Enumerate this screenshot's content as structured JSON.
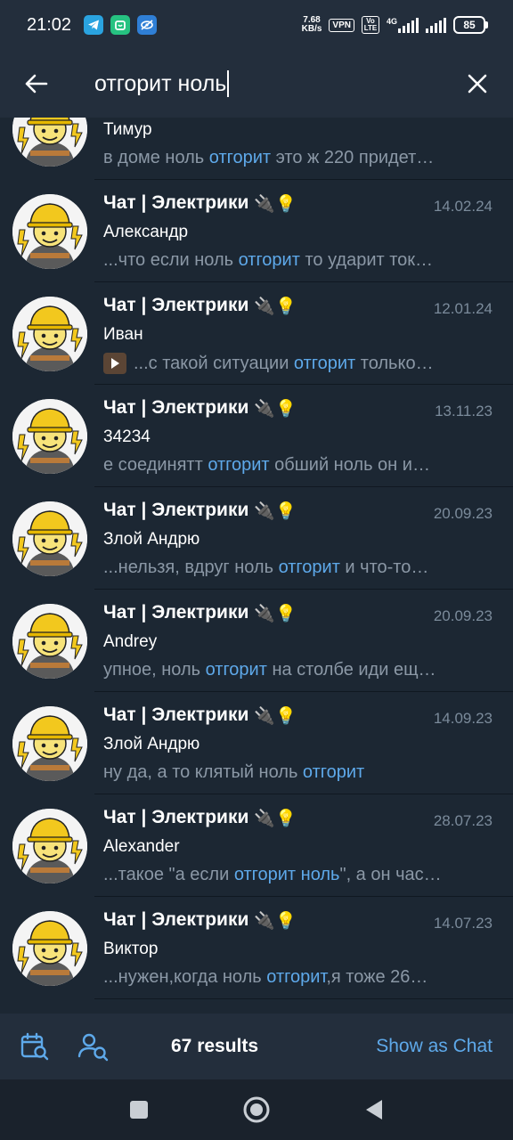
{
  "status_bar": {
    "time": "21:02",
    "net_speed_value": "7.68",
    "net_speed_unit": "KB/s",
    "vpn": "VPN",
    "volte": "Vo LTE",
    "network": "4G",
    "battery": "85",
    "icons": [
      "telegram-icon",
      "app-icon",
      "eye-slash-icon",
      "signal-icon",
      "battery-icon"
    ]
  },
  "search": {
    "query": "отгорит ноль"
  },
  "results": [
    {
      "title": "",
      "emoji": "",
      "date": "",
      "author": "Тимур",
      "snippet": [
        {
          "t": "в доме ноль ",
          "h": false
        },
        {
          "t": "отгорит",
          "h": true
        },
        {
          "t": " это ж 220 придет…",
          "h": false
        }
      ],
      "video": false
    },
    {
      "title": "Чат | Электрики",
      "emoji": "🔌💡",
      "date": "14.02.24",
      "author": "Александр",
      "snippet": [
        {
          "t": "...что если ноль ",
          "h": false
        },
        {
          "t": "отгорит",
          "h": true
        },
        {
          "t": " то ударит ток…",
          "h": false
        }
      ],
      "video": false
    },
    {
      "title": "Чат | Электрики",
      "emoji": "🔌💡",
      "date": "12.01.24",
      "author": "Иван",
      "snippet": [
        {
          "t": "...с такой ситуации ",
          "h": false
        },
        {
          "t": "отгорит",
          "h": true
        },
        {
          "t": " только…",
          "h": false
        }
      ],
      "video": true
    },
    {
      "title": "Чат | Электрики",
      "emoji": "🔌💡",
      "date": "13.11.23",
      "author": "34234",
      "snippet": [
        {
          "t": "е соединятт ",
          "h": false
        },
        {
          "t": "отгорит",
          "h": true
        },
        {
          "t": " обший ноль он и…",
          "h": false
        }
      ],
      "video": false
    },
    {
      "title": "Чат | Электрики",
      "emoji": "🔌💡",
      "date": "20.09.23",
      "author": "Злой Андрю",
      "snippet": [
        {
          "t": "...нельзя, вдруг ноль ",
          "h": false
        },
        {
          "t": "отгорит",
          "h": true
        },
        {
          "t": " и что-то…",
          "h": false
        }
      ],
      "video": false
    },
    {
      "title": "Чат | Электрики",
      "emoji": "🔌💡",
      "date": "20.09.23",
      "author": "Andrey",
      "snippet": [
        {
          "t": "упное, ноль ",
          "h": false
        },
        {
          "t": "отгорит",
          "h": true
        },
        {
          "t": " на столбе иди ещ…",
          "h": false
        }
      ],
      "video": false
    },
    {
      "title": "Чат | Электрики",
      "emoji": "🔌💡",
      "date": "14.09.23",
      "author": "Злой Андрю",
      "snippet": [
        {
          "t": "ну да, а то клятый ноль ",
          "h": false
        },
        {
          "t": "отгорит",
          "h": true
        }
      ],
      "video": false
    },
    {
      "title": "Чат | Электрики",
      "emoji": "🔌💡",
      "date": "28.07.23",
      "author": "Alexander",
      "snippet": [
        {
          "t": "...такое \"а если ",
          "h": false
        },
        {
          "t": "отгорит ноль",
          "h": true
        },
        {
          "t": "\", а он час…",
          "h": false
        }
      ],
      "video": false
    },
    {
      "title": "Чат | Электрики",
      "emoji": "🔌💡",
      "date": "14.07.23",
      "author": "Виктор",
      "snippet": [
        {
          "t": "...нужен,когда ноль ",
          "h": false
        },
        {
          "t": "отгорит",
          "h": true
        },
        {
          "t": ",я тоже 26…",
          "h": false
        }
      ],
      "video": false
    }
  ],
  "bottom_bar": {
    "count_label": "67 results",
    "show_as_chat": "Show as Chat"
  },
  "colors": {
    "background": "#1c2733",
    "header": "#232e3c",
    "accent": "#5ea9ea",
    "secondary_text": "#8b98a6",
    "date_text": "#7b8b9b"
  }
}
